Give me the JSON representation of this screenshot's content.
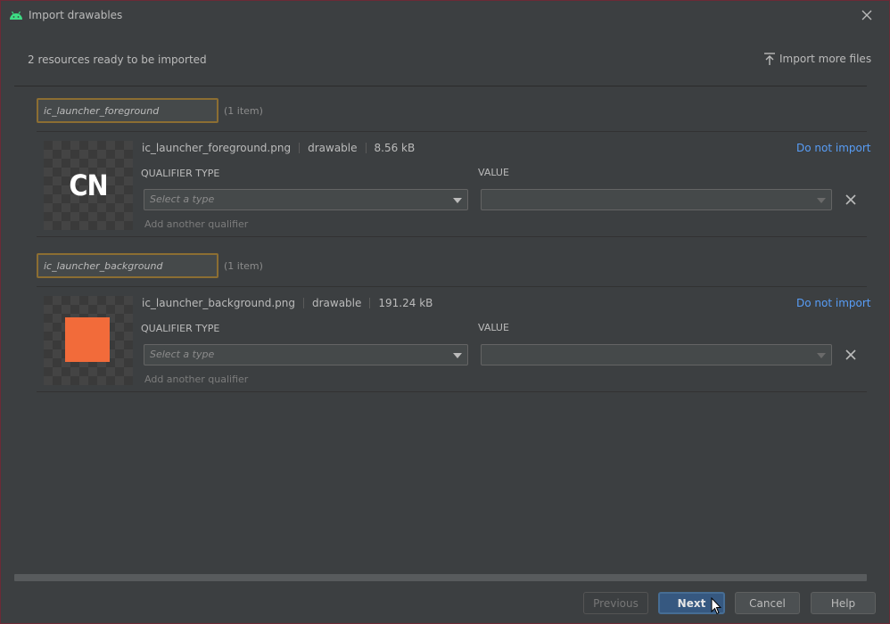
{
  "window": {
    "title": "Import drawables"
  },
  "header": {
    "summary": "2 resources ready to be imported",
    "import_more_label": "Import more files"
  },
  "groups": [
    {
      "name": "ic_launcher_foreground",
      "count": "(1 item)",
      "preview_text": "CN",
      "file": {
        "name": "ic_launcher_foreground.png",
        "type": "drawable",
        "size": "8.56 kB"
      },
      "do_not_import": "Do not import",
      "qualifier_type_label": "QUALIFIER TYPE",
      "value_label": "VALUE",
      "qualifier_placeholder": "Select a type",
      "value": "",
      "add_qualifier": "Add another qualifier"
    },
    {
      "name": "ic_launcher_background",
      "count": "(1 item)",
      "preview_color": "#f26b3a",
      "file": {
        "name": "ic_launcher_background.png",
        "type": "drawable",
        "size": "191.24 kB"
      },
      "do_not_import": "Do not import",
      "qualifier_type_label": "QUALIFIER TYPE",
      "value_label": "VALUE",
      "qualifier_placeholder": "Select a type",
      "value": "",
      "add_qualifier": "Add another qualifier"
    }
  ],
  "footer": {
    "previous_label": "Previous",
    "next_label": "Next",
    "cancel_label": "Cancel",
    "help_label": "Help"
  },
  "colors": {
    "background": "#3c3f41",
    "accent_link": "#589df6",
    "focus_border": "#8c6e32",
    "primary_button": "#365880",
    "android_green": "#3ddc84"
  },
  "icons": {
    "app": "android-icon",
    "close": "close-icon",
    "import_more": "upload-icon",
    "remove_qualifier": "close-icon",
    "dropdown": "chevron-down-icon"
  }
}
